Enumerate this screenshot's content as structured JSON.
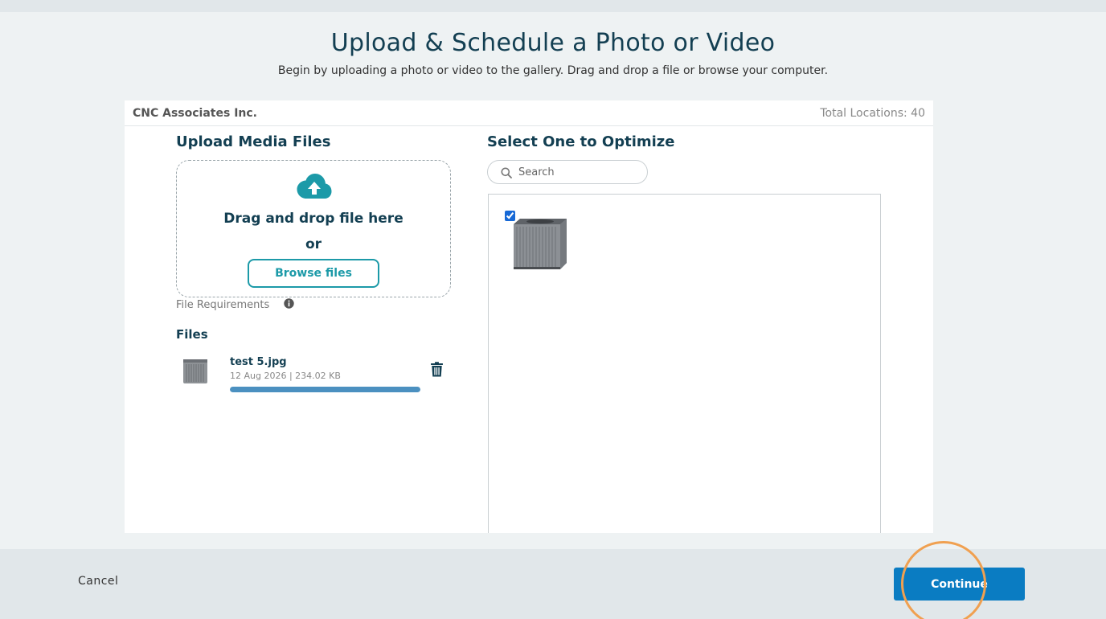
{
  "header": {
    "title": "Upload & Schedule a Photo or Video",
    "subtitle": "Begin by uploading a photo or video to the gallery. Drag and drop a file or browse your computer."
  },
  "card": {
    "company": "CNC Associates Inc.",
    "total_locations": "Total Locations: 40"
  },
  "upload": {
    "title": "Upload Media Files",
    "drag_text": "Drag and drop file here",
    "or_text": "or",
    "browse_label": "Browse files",
    "requirements_label": "File Requirements",
    "files_title": "Files",
    "files": [
      {
        "name": "test 5.jpg",
        "meta": "12 Aug 2026 |  234.02 KB",
        "progress_percent": 100
      }
    ]
  },
  "optimize": {
    "title": "Select One to Optimize",
    "search_placeholder": "Search",
    "gallery_items": [
      {
        "checked": true,
        "icon": "air-conditioner-unit-image"
      }
    ]
  },
  "footer": {
    "cancel_label": "Cancel",
    "continue_label": "Continue"
  },
  "colors": {
    "primary": "#0a7cc2",
    "accent": "#1c9aa8",
    "heading": "#133f52",
    "highlight": "#f0a050"
  }
}
